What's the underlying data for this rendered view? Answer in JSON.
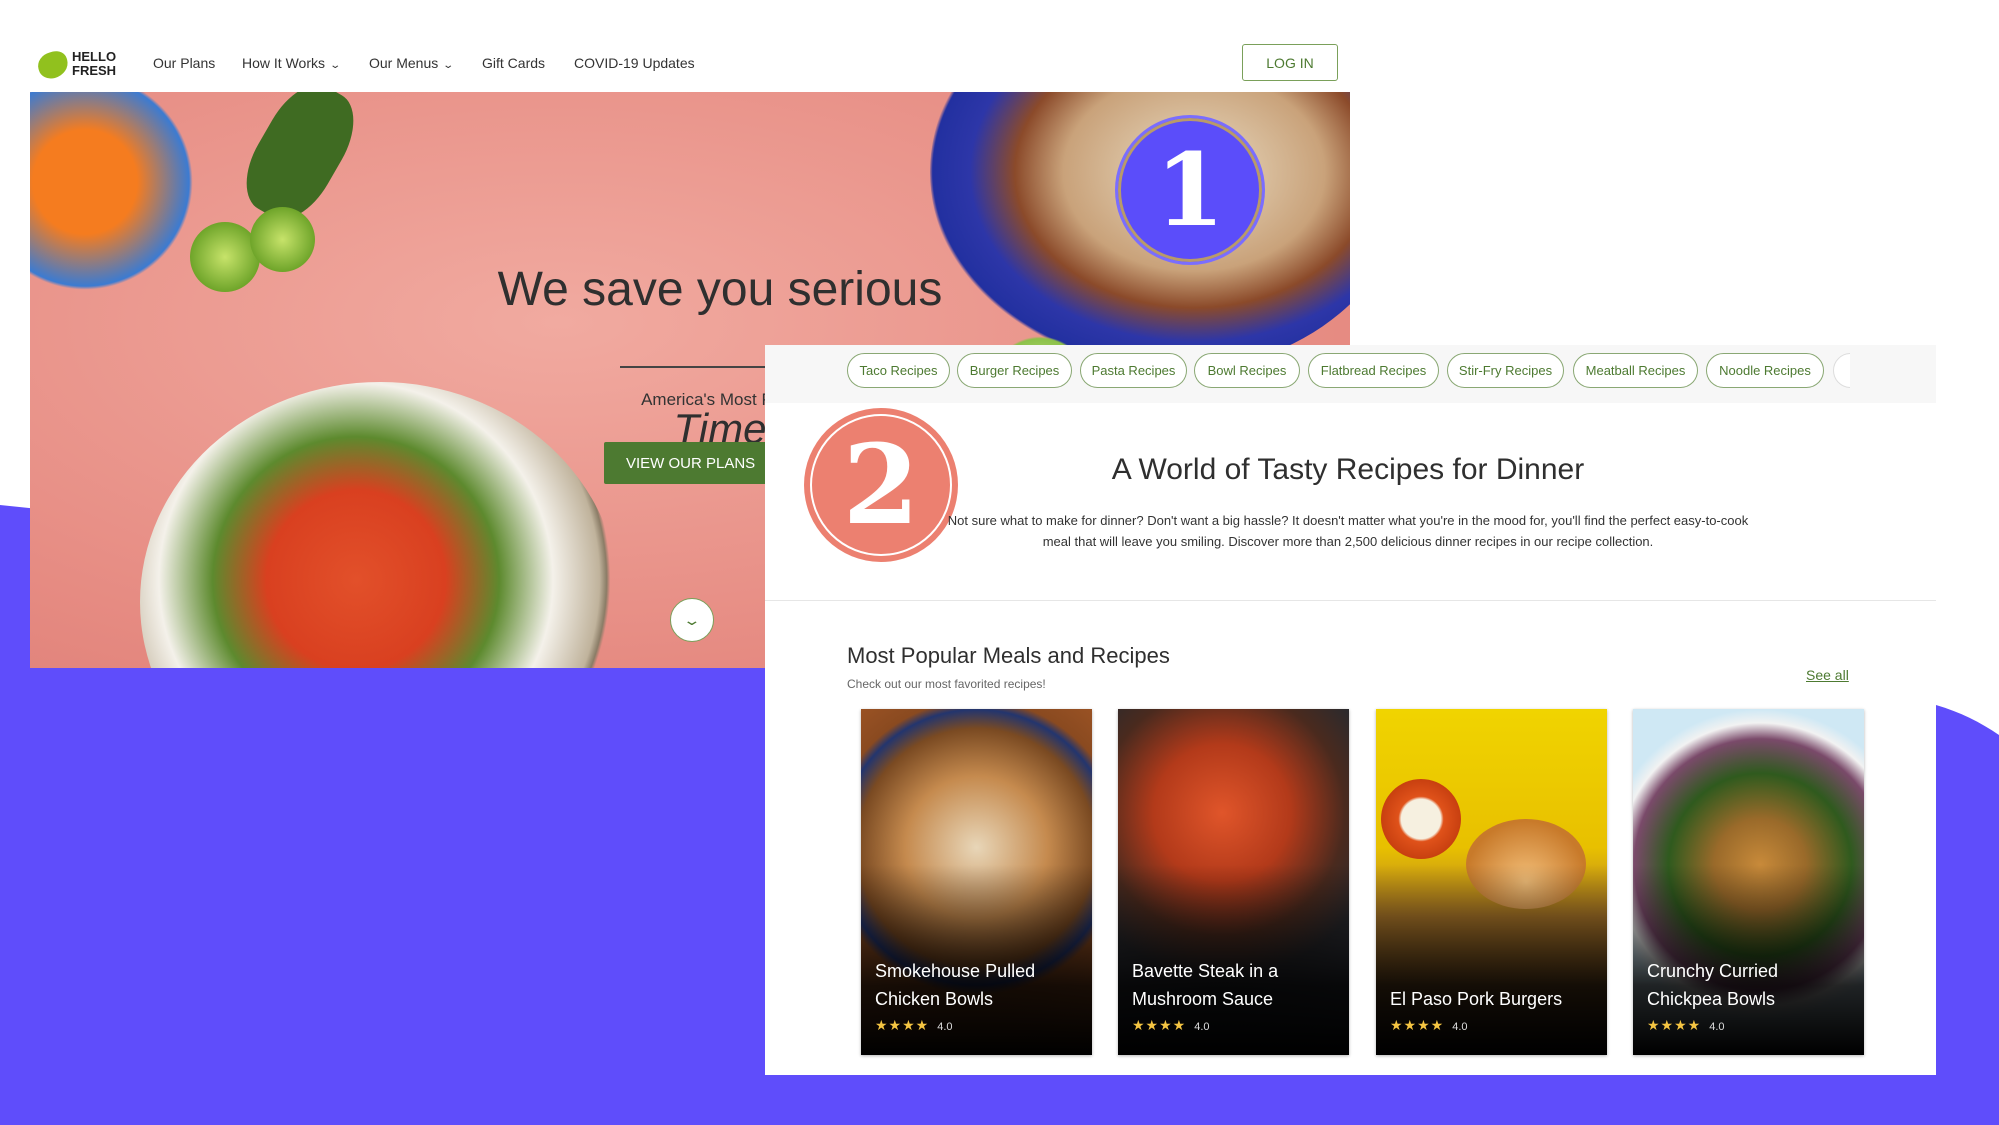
{
  "colors": {
    "accent_green": "#4d7a31",
    "purple_bg": "#5f4dfb",
    "badge_purple": "#5b4dfa",
    "badge_salmon": "#ec8070",
    "hero_pink": "#e8948a"
  },
  "logo": {
    "line1": "HELLO",
    "line2": "FRESH"
  },
  "nav": {
    "items": [
      {
        "label": "Our Plans"
      },
      {
        "label": "How It Works",
        "dropdown": true
      },
      {
        "label": "Our Menus",
        "dropdown": true
      },
      {
        "label": "Gift Cards"
      },
      {
        "label": "COVID-19 Updates"
      }
    ],
    "login": "LOG IN",
    "chevron": "⌄"
  },
  "hero": {
    "headline": "We save you serious",
    "headline_italic": "Time",
    "subtitle": "America's Most Popular M",
    "cta": "VIEW OUR PLANS",
    "scroll_icon": "chevron-down-icon"
  },
  "badges": {
    "one": "1",
    "two": "2"
  },
  "recipes_page": {
    "chips": [
      "Taco Recipes",
      "Burger Recipes",
      "Pasta Recipes",
      "Bowl Recipes",
      "Flatbread Recipes",
      "Stir-Fry Recipes",
      "Meatball Recipes",
      "Noodle Recipes"
    ],
    "title": "A World of Tasty Recipes for Dinner",
    "paragraph": "Not sure what to make for dinner? Don't want a big hassle? It doesn't matter what you're in the mood for, you'll find the perfect easy-to-cook meal that will leave you smiling. Discover more than 2,500 delicious dinner recipes in our recipe collection.",
    "popular_title": "Most Popular Meals and Recipes",
    "popular_subtitle": "Check out our most favorited recipes!",
    "see_all": "See all",
    "cards": [
      {
        "title": "Smokehouse Pulled Chicken Bowls",
        "stars": "★★★★",
        "rating": "4.0"
      },
      {
        "title": "Bavette Steak in a Mushroom Sauce",
        "stars": "★★★★",
        "rating": "4.0"
      },
      {
        "title": "El Paso Pork Burgers",
        "stars": "★★★★",
        "rating": "4.0"
      },
      {
        "title": "Crunchy Curried Chickpea Bowls",
        "stars": "★★★★",
        "rating": "4.0"
      }
    ]
  }
}
